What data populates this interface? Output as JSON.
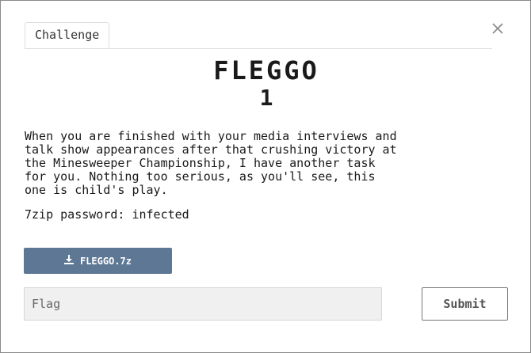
{
  "tabs": [
    {
      "label": "Challenge",
      "active": true
    }
  ],
  "close_icon": "close-icon",
  "challenge": {
    "title": "FLEGGO",
    "points": "1",
    "description": "When you are finished with your media interviews and\ntalk show appearances after that crushing victory at\nthe Minesweeper Championship, I have another task\nfor you. Nothing too serious, as you'll see, this\none is child's play.",
    "password_note": "7zip password: infected"
  },
  "download": {
    "label": "FLEGGO.7z",
    "icon": "download-icon",
    "color": "#5e7795"
  },
  "flag_input": {
    "placeholder": "Flag",
    "value": ""
  },
  "submit": {
    "label": "Submit"
  }
}
